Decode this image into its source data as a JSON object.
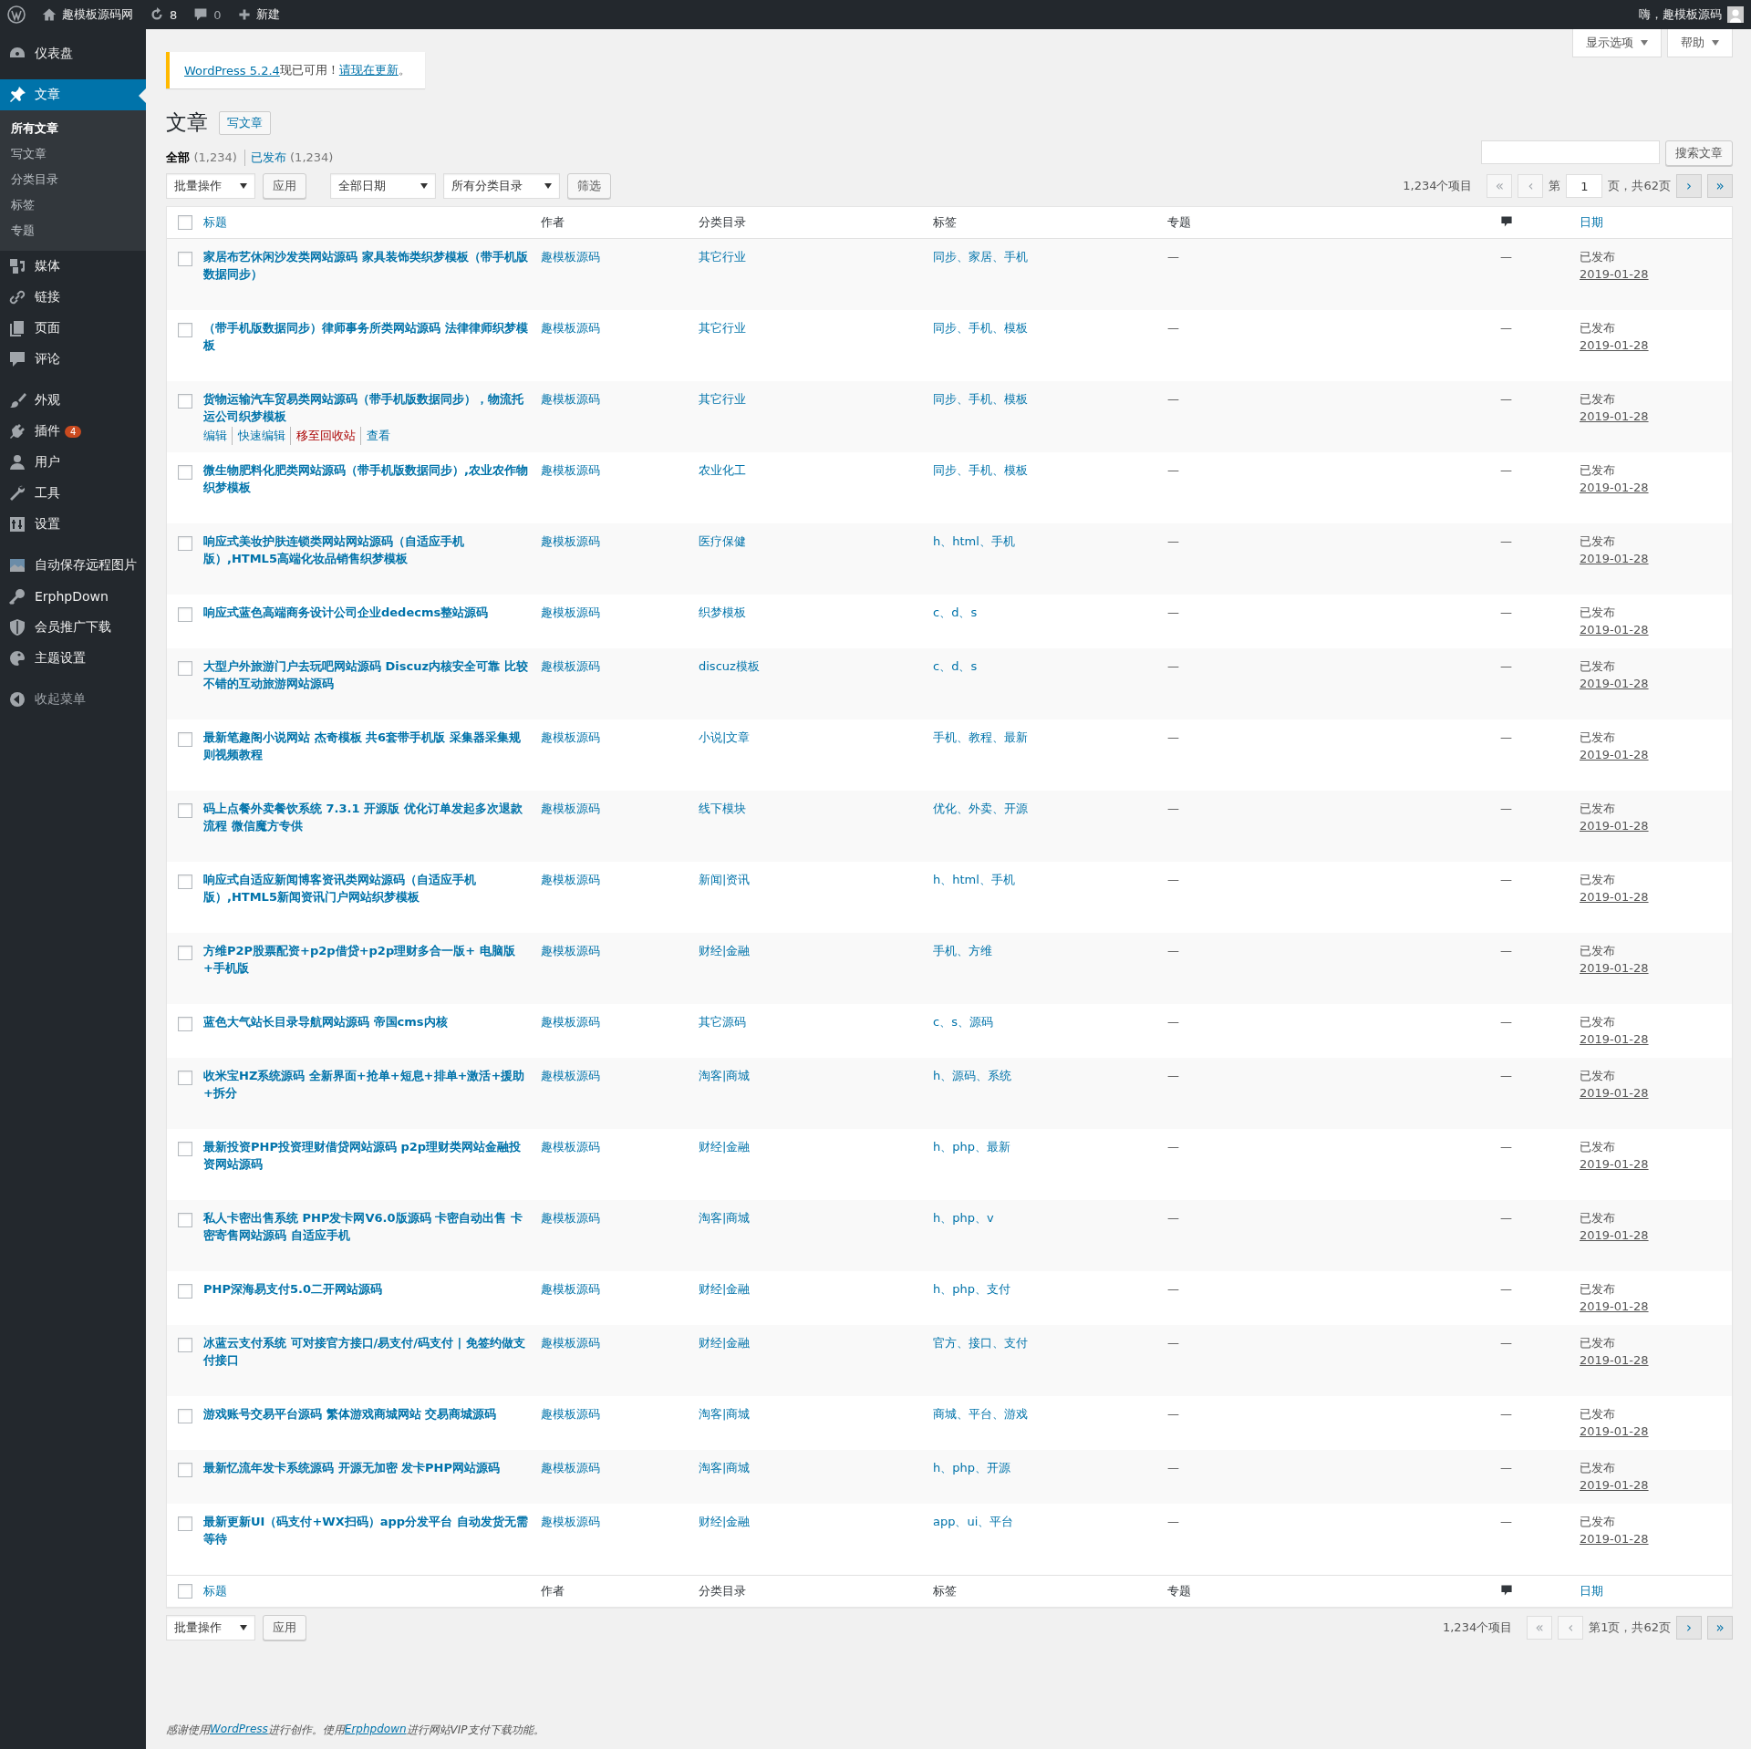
{
  "admin_bar": {
    "site_name": "趣模板源码网",
    "updates": "8",
    "comments": "0",
    "new_label": "新建",
    "greeting": "嗨，趣模板源码"
  },
  "sidebar": {
    "groups": [
      [
        {
          "label": "仪表盘",
          "selected": false
        }
      ],
      [
        {
          "label": "文章",
          "selected": true,
          "children": [
            {
              "label": "所有文章",
              "selected": true
            },
            {
              "label": "写文章",
              "selected": false
            },
            {
              "label": "分类目录",
              "selected": false
            },
            {
              "label": "标签",
              "selected": false
            },
            {
              "label": "专题",
              "selected": false
            }
          ]
        },
        {
          "label": "媒体",
          "selected": false
        },
        {
          "label": "链接",
          "selected": false
        },
        {
          "label": "页面",
          "selected": false
        },
        {
          "label": "评论",
          "selected": false
        }
      ],
      [
        {
          "label": "外观",
          "selected": false
        },
        {
          "label": "插件",
          "selected": false,
          "badge": "4"
        },
        {
          "label": "用户",
          "selected": false
        },
        {
          "label": "工具",
          "selected": false
        },
        {
          "label": "设置",
          "selected": false
        }
      ],
      [
        {
          "label": "自动保存远程图片",
          "selected": false
        },
        {
          "label": "ErphpDown",
          "selected": false
        },
        {
          "label": "会员推广下载",
          "selected": false
        },
        {
          "label": "主题设置",
          "selected": false
        }
      ]
    ],
    "collapse_label": "收起菜单"
  },
  "screen_meta": [
    "显示选项",
    "帮助"
  ],
  "notice": [
    {
      "text": "WordPress 5.2.4",
      "kind": "link"
    },
    {
      "text": "现已可用！",
      "kind": "text"
    },
    {
      "text": "请现在更新",
      "kind": "link"
    },
    {
      "text": "。",
      "kind": "text"
    }
  ],
  "page_title": "文章",
  "add_new": "写文章",
  "views": [
    {
      "label": "全部",
      "count": "(1,234)",
      "selected": true
    },
    {
      "label": "已发布",
      "count": "(1,234)",
      "selected": false
    }
  ],
  "search_button": "搜索文章",
  "tablenav_top": {
    "bulk": "批量操作",
    "apply": "应用",
    "date_filter": "全部日期",
    "category_filter": "所有分类目录",
    "filter": "筛选",
    "pagination": {
      "count": "1,234个项目",
      "first": {
        "label": "«",
        "disabled": true
      },
      "prev": {
        "label": "‹",
        "disabled": true
      },
      "page_prefix": "第",
      "page": "1",
      "page_suffix": "页，共62页",
      "next": {
        "label": "›",
        "disabled": false
      },
      "last": {
        "label": "»",
        "disabled": false
      }
    }
  },
  "table": {
    "select_all_checked": false,
    "footer_select_all_checked": false,
    "columns": [
      "标题",
      "作者",
      "分类目录",
      "标签",
      "专题",
      "日期"
    ],
    "rows": [
      {
        "title": "家居布艺休闲沙发类网站源码 家具装饰类织梦模板（带手机版数据同步）",
        "author": "趣模板源码",
        "category": "其它行业",
        "tags": "同步、家居、手机",
        "topic": "—",
        "comments": "—",
        "status": "已发布",
        "date": "2019-01-28",
        "checked": false
      },
      {
        "title": "（带手机版数据同步）律师事务所类网站源码 法律律师织梦模板",
        "author": "趣模板源码",
        "category": "其它行业",
        "tags": "同步、手机、模板",
        "topic": "—",
        "comments": "—",
        "status": "已发布",
        "date": "2019-01-28",
        "checked": false
      },
      {
        "title": "货物运输汽车贸易类网站源码（带手机版数据同步），物流托运公司织梦模板",
        "author": "趣模板源码",
        "category": "其它行业",
        "tags": "同步、手机、模板",
        "topic": "—",
        "comments": "—",
        "status": "已发布",
        "date": "2019-01-28",
        "checked": false,
        "actions": [
          {
            "label": "编辑",
            "kind": "link"
          },
          {
            "label": "快速编辑",
            "kind": "link"
          },
          {
            "label": "移至回收站",
            "kind": "trash"
          },
          {
            "label": "查看",
            "kind": "link"
          }
        ]
      },
      {
        "title": "微生物肥料化肥类网站源码（带手机版数据同步）,农业农作物织梦模板",
        "author": "趣模板源码",
        "category": "农业化工",
        "tags": "同步、手机、模板",
        "topic": "—",
        "comments": "—",
        "status": "已发布",
        "date": "2019-01-28",
        "checked": false
      },
      {
        "title": "响应式美妆护肤连锁类网站网站源码（自适应手机版）,HTML5高端化妆品销售织梦模板",
        "author": "趣模板源码",
        "category": "医疗保健",
        "tags": "h、html、手机",
        "topic": "—",
        "comments": "—",
        "status": "已发布",
        "date": "2019-01-28",
        "checked": false
      },
      {
        "title": "响应式蓝色高端商务设计公司企业dedecms整站源码",
        "author": "趣模板源码",
        "category": "织梦模板",
        "tags": "c、d、s",
        "topic": "—",
        "comments": "—",
        "status": "已发布",
        "date": "2019-01-28",
        "checked": false
      },
      {
        "title": "大型户外旅游门户去玩吧网站源码 Discuz内核安全可靠 比较不错的互动旅游网站源码",
        "author": "趣模板源码",
        "category": "discuz模板",
        "tags": "c、d、s",
        "topic": "—",
        "comments": "—",
        "status": "已发布",
        "date": "2019-01-28",
        "checked": false
      },
      {
        "title": "最新笔趣阁小说网站 杰奇模板 共6套带手机版 采集器采集规则视频教程",
        "author": "趣模板源码",
        "category": "小说|文章",
        "tags": "手机、教程、最新",
        "topic": "—",
        "comments": "—",
        "status": "已发布",
        "date": "2019-01-28",
        "checked": false
      },
      {
        "title": "码上点餐外卖餐饮系统 7.3.1 开源版 优化订单发起多次退款流程 微信魔方专供",
        "author": "趣模板源码",
        "category": "线下模块",
        "tags": "优化、外卖、开源",
        "topic": "—",
        "comments": "—",
        "status": "已发布",
        "date": "2019-01-28",
        "checked": false
      },
      {
        "title": "响应式自适应新闻博客资讯类网站源码（自适应手机版）,HTML5新闻资讯门户网站织梦模板",
        "author": "趣模板源码",
        "category": "新闻|资讯",
        "tags": "h、html、手机",
        "topic": "—",
        "comments": "—",
        "status": "已发布",
        "date": "2019-01-28",
        "checked": false
      },
      {
        "title": "方维P2P股票配资+p2p借贷+p2p理财多合一版+ 电脑版+手机版",
        "author": "趣模板源码",
        "category": "财经|金融",
        "tags": "手机、方维",
        "topic": "—",
        "comments": "—",
        "status": "已发布",
        "date": "2019-01-28",
        "checked": false
      },
      {
        "title": "蓝色大气站长目录导航网站源码 帝国cms内核",
        "author": "趣模板源码",
        "category": "其它源码",
        "tags": "c、s、源码",
        "topic": "—",
        "comments": "—",
        "status": "已发布",
        "date": "2019-01-28",
        "checked": false
      },
      {
        "title": "收米宝HZ系统源码 全新界面+抢单+短息+排单+激活+援助+拆分",
        "author": "趣模板源码",
        "category": "淘客|商城",
        "tags": "h、源码、系统",
        "topic": "—",
        "comments": "—",
        "status": "已发布",
        "date": "2019-01-28",
        "checked": false
      },
      {
        "title": "最新投资PHP投资理财借贷网站源码 p2p理财类网站金融投资网站源码",
        "author": "趣模板源码",
        "category": "财经|金融",
        "tags": "h、php、最新",
        "topic": "—",
        "comments": "—",
        "status": "已发布",
        "date": "2019-01-28",
        "checked": false
      },
      {
        "title": "私人卡密出售系统 PHP发卡网V6.0版源码 卡密自动出售 卡密寄售网站源码 自适应手机",
        "author": "趣模板源码",
        "category": "淘客|商城",
        "tags": "h、php、v",
        "topic": "—",
        "comments": "—",
        "status": "已发布",
        "date": "2019-01-28",
        "checked": false
      },
      {
        "title": "PHP深海易支付5.0二开网站源码",
        "author": "趣模板源码",
        "category": "财经|金融",
        "tags": "h、php、支付",
        "topic": "—",
        "comments": "—",
        "status": "已发布",
        "date": "2019-01-28",
        "checked": false
      },
      {
        "title": "冰蓝云支付系统 可对接官方接口/易支付/码支付 | 免签约做支付接口",
        "author": "趣模板源码",
        "category": "财经|金融",
        "tags": "官方、接口、支付",
        "topic": "—",
        "comments": "—",
        "status": "已发布",
        "date": "2019-01-28",
        "checked": false
      },
      {
        "title": "游戏账号交易平台源码 繁体游戏商城网站 交易商城源码",
        "author": "趣模板源码",
        "category": "淘客|商城",
        "tags": "商城、平台、游戏",
        "topic": "—",
        "comments": "—",
        "status": "已发布",
        "date": "2019-01-28",
        "checked": false
      },
      {
        "title": "最新忆流年发卡系统源码 开源无加密 发卡PHP网站源码",
        "author": "趣模板源码",
        "category": "淘客|商城",
        "tags": "h、php、开源",
        "topic": "—",
        "comments": "—",
        "status": "已发布",
        "date": "2019-01-28",
        "checked": false
      },
      {
        "title": "最新更新UI（码支付+WX扫码）app分发平台 自动发货无需等待",
        "author": "趣模板源码",
        "category": "财经|金融",
        "tags": "app、ui、平台",
        "topic": "—",
        "comments": "—",
        "status": "已发布",
        "date": "2019-01-28",
        "checked": false
      }
    ],
    "footer_columns": [
      "标题",
      "作者",
      "分类目录",
      "标签",
      "专题",
      "日期"
    ]
  },
  "tablenav_bottom": {
    "bulk": "批量操作",
    "apply": "应用",
    "pagination": {
      "count": "1,234个项目",
      "first": {
        "label": "«",
        "disabled": true
      },
      "prev": {
        "label": "‹",
        "disabled": true
      },
      "page_text": "第1页，共62页",
      "next": {
        "label": "›",
        "disabled": false
      },
      "last": {
        "label": "»",
        "disabled": false
      }
    }
  },
  "footer": [
    {
      "text": "感谢使用",
      "kind": "text"
    },
    {
      "text": "WordPress",
      "kind": "link"
    },
    {
      "text": "进行创作。使用",
      "kind": "text"
    },
    {
      "text": "Erphpdown",
      "kind": "link"
    },
    {
      "text": "进行网站VIP支付下载功能。",
      "kind": "text"
    }
  ]
}
